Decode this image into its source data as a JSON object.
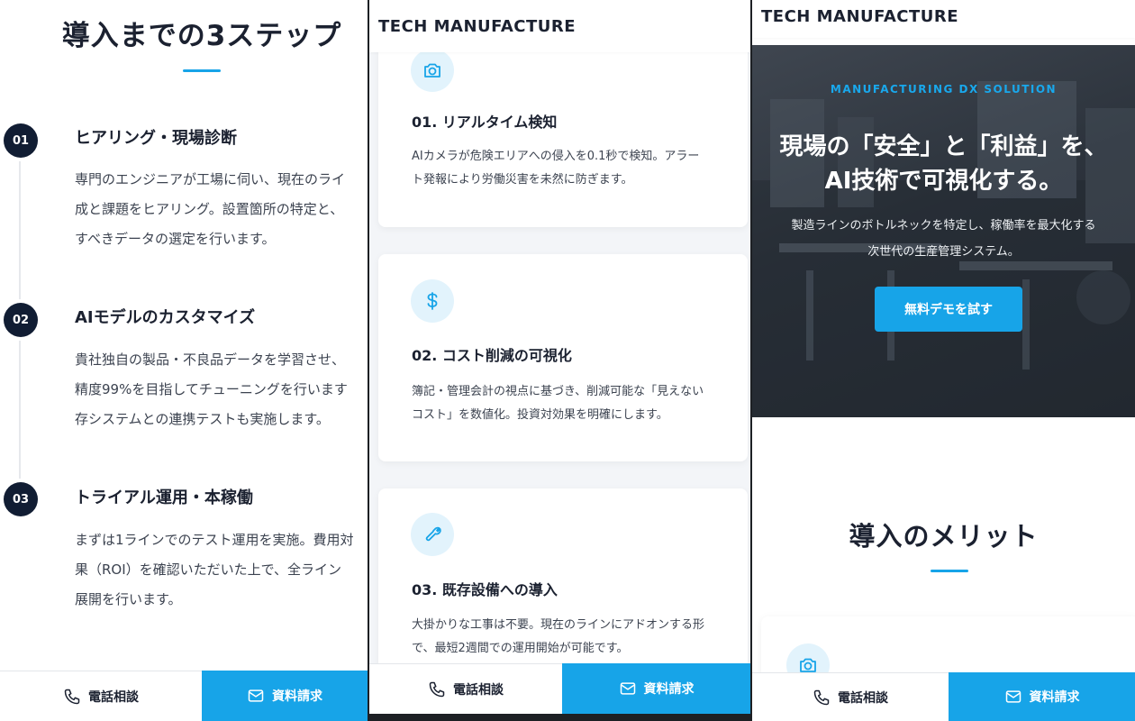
{
  "brand": "TECH MANUFACTURE",
  "bottom_bar": {
    "phone_label": "電話相談",
    "mail_label": "資料請求",
    "phone_icon": "phone-icon",
    "mail_icon": "mail-icon"
  },
  "steps_section": {
    "title": "導入までの3ステップ",
    "steps": [
      {
        "number": "01",
        "title": "ヒアリング・現場診断",
        "desc_lines": [
          "専門のエンジニアが工場に伺い、現在のライ",
          "成と課題をヒアリング。設置箇所の特定と、",
          "すべきデータの選定を行います。"
        ]
      },
      {
        "number": "02",
        "title": "AIモデルのカスタマイズ",
        "desc_lines": [
          "貴社独自の製品・不良品データを学習させ、",
          "精度99%を目指してチューニングを行います",
          "存システムとの連携テストも実施します。"
        ]
      },
      {
        "number": "03",
        "title": "トライアル運用・本稼働",
        "desc_lines": [
          "まずは1ラインでのテスト運用を実施。費用対",
          "果（ROI）を確認いただいた上で、全ライン",
          "展開を行います。"
        ]
      }
    ]
  },
  "features": [
    {
      "icon": "camera-icon",
      "title": "01. リアルタイム検知",
      "desc_lines": [
        "AIカメラが危険エリアへの侵入を0.1秒で検知。アラー",
        "ト発報により労働災害を未然に防ぎます。"
      ]
    },
    {
      "icon": "dollar-icon",
      "title": "02. コスト削減の可視化",
      "desc_lines": [
        "簿記・管理会計の視点に基づき、削減可能な「見えない",
        "コスト」を数値化。投資対効果を明確にします。"
      ]
    },
    {
      "icon": "wrench-icon",
      "title": "03. 既存設備への導入",
      "desc_lines": [
        "大掛かりな工事は不要。現在のラインにアドオンする形",
        "で、最短2週間での運用開始が可能です。"
      ]
    }
  ],
  "hero": {
    "overline": "MANUFACTURING DX SOLUTION",
    "title_lines": [
      "現場の「安全」と「利益」を、",
      "AI技術で可視化する。"
    ],
    "subtitle_lines": [
      "製造ラインのボトルネックを特定し、稼働率を最大化する",
      "次世代の生産管理システム。"
    ],
    "cta_label": "無料デモを試す"
  },
  "merits": {
    "title": "導入のメリット",
    "peek_icon": "camera-icon"
  },
  "colors": {
    "accent": "#17a4e8",
    "dark_navy": "#111d33",
    "text": "#1b2130"
  }
}
